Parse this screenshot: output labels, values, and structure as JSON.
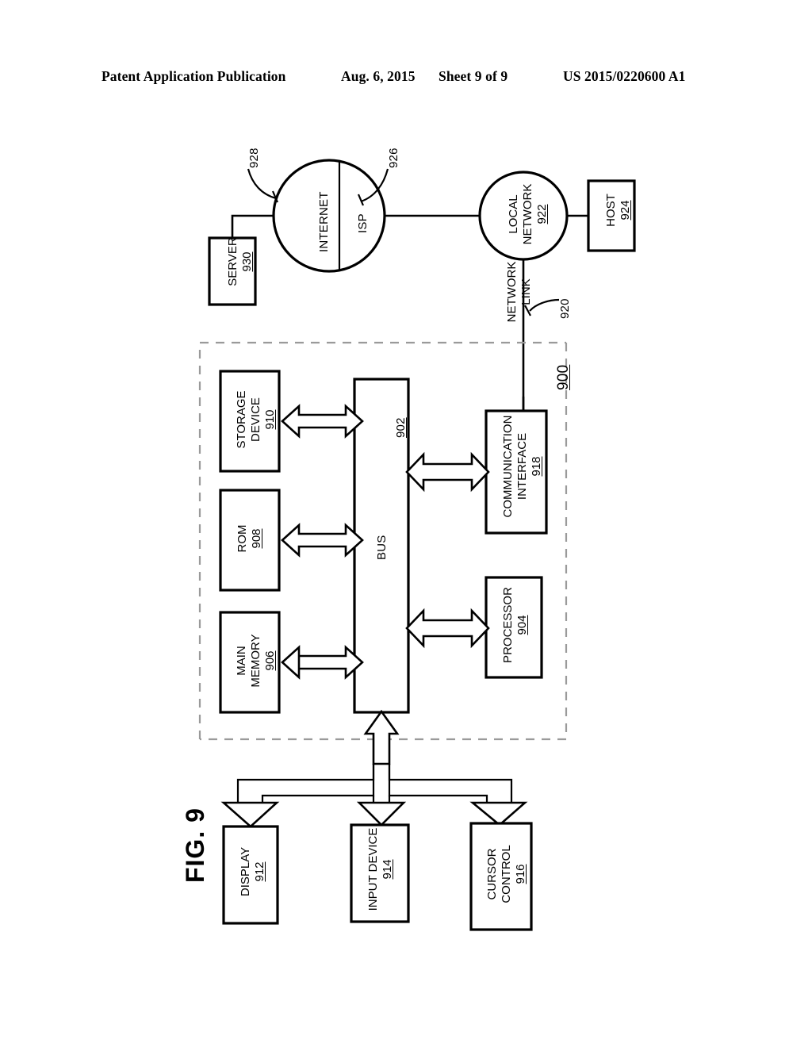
{
  "header": {
    "publication": "Patent Application Publication",
    "date": "Aug. 6, 2015",
    "sheet": "Sheet 9 of 9",
    "patent_number": "US 2015/0220600 A1"
  },
  "figure": {
    "label": "FIG. 9",
    "system_ref": "900"
  },
  "nodes": {
    "server": {
      "label": "SERVER",
      "ref": "930"
    },
    "internet": {
      "label": "INTERNET",
      "ref": "928"
    },
    "isp": {
      "label": "ISP",
      "ref": "926"
    },
    "local_network": {
      "label_line1": "LOCAL",
      "label_line2": "NETWORK",
      "ref": "922"
    },
    "host": {
      "label": "HOST",
      "ref": "924"
    },
    "network_link": {
      "label_line1": "NETWORK",
      "label_line2": "LINK",
      "ref": "920"
    },
    "storage_device": {
      "label_line1": "STORAGE",
      "label_line2": "DEVICE",
      "ref": "910"
    },
    "rom": {
      "label": "ROM",
      "ref": "908"
    },
    "main_memory": {
      "label_line1": "MAIN",
      "label_line2": "MEMORY",
      "ref": "906"
    },
    "bus": {
      "label": "BUS",
      "ref": "902"
    },
    "communication_interface": {
      "label_line1": "COMMUNICATION",
      "label_line2": "INTERFACE",
      "ref": "918"
    },
    "processor": {
      "label": "PROCESSOR",
      "ref": "904"
    },
    "display": {
      "label": "DISPLAY",
      "ref": "912"
    },
    "input_device": {
      "label": "INPUT DEVICE",
      "ref": "914"
    },
    "cursor_control": {
      "label_line1": "CURSOR",
      "label_line2": "CONTROL",
      "ref": "916"
    }
  },
  "colors": {
    "ink": "#000000",
    "paper": "#ffffff",
    "dashed_boundary": "#9a9a9a"
  }
}
